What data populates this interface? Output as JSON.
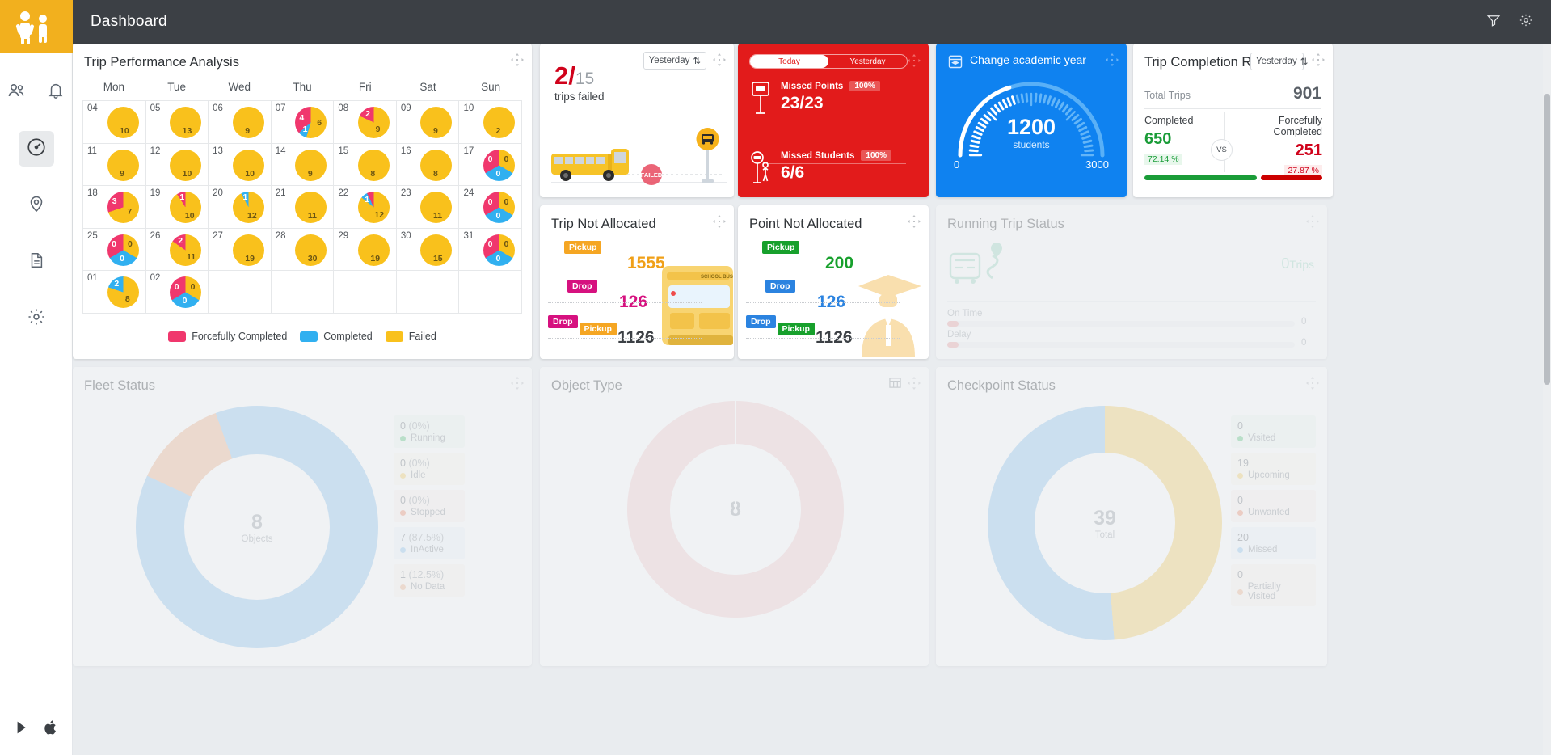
{
  "app": {
    "header_title": "Dashboard",
    "header_icons": [
      "filter-icon",
      "gear-icon"
    ],
    "rail_icons": [
      "users-icon",
      "bell-icon",
      "speedometer-icon",
      "map-pin-icon",
      "document-icon",
      "settings-icon"
    ],
    "rail_bottom_icons": [
      "android-icon",
      "apple-icon"
    ]
  },
  "trip_performance": {
    "title": "Trip Performance Analysis",
    "day_headers": [
      "Mon",
      "Tue",
      "Wed",
      "Thu",
      "Fri",
      "Sat",
      "Sun"
    ],
    "legend": [
      {
        "label": "Forcefully Completed",
        "color": "#f0376d"
      },
      {
        "label": "Completed",
        "color": "#31b0f0"
      },
      {
        "label": "Failed",
        "color": "#f9c11c"
      }
    ],
    "weeks": [
      [
        {
          "day": "04",
          "slices": [
            {
              "v": 10,
              "color": "#f9c11c",
              "show": true
            }
          ]
        },
        {
          "day": "05",
          "slices": [
            {
              "v": 13,
              "color": "#f9c11c",
              "show": true
            }
          ]
        },
        {
          "day": "06",
          "slices": [
            {
              "v": 9,
              "color": "#f9c11c",
              "show": true
            }
          ]
        },
        {
          "day": "07",
          "slices": [
            {
              "v": 6,
              "color": "#f9c11c",
              "show": true
            },
            {
              "v": 1,
              "color": "#31b0f0",
              "show": true
            },
            {
              "v": 4,
              "color": "#f0376d",
              "show": true
            }
          ]
        },
        {
          "day": "08",
          "slices": [
            {
              "v": 9,
              "color": "#f9c11c",
              "show": true
            },
            {
              "v": 2,
              "color": "#f0376d",
              "show": true
            }
          ]
        },
        {
          "day": "09",
          "slices": [
            {
              "v": 9,
              "color": "#f9c11c",
              "show": true
            }
          ]
        },
        {
          "day": "10",
          "slices": [
            {
              "v": 2,
              "color": "#f9c11c",
              "show": true
            }
          ]
        }
      ],
      [
        {
          "day": "11",
          "slices": [
            {
              "v": 9,
              "color": "#f9c11c",
              "show": true
            }
          ]
        },
        {
          "day": "12",
          "slices": [
            {
              "v": 10,
              "color": "#f9c11c",
              "show": true
            }
          ]
        },
        {
          "day": "13",
          "slices": [
            {
              "v": 10,
              "color": "#f9c11c",
              "show": true
            }
          ]
        },
        {
          "day": "14",
          "slices": [
            {
              "v": 9,
              "color": "#f9c11c",
              "show": true
            }
          ]
        },
        {
          "day": "15",
          "slices": [
            {
              "v": 8,
              "color": "#f9c11c",
              "show": true
            }
          ]
        },
        {
          "day": "16",
          "slices": [
            {
              "v": 8,
              "color": "#f9c11c",
              "show": true
            }
          ]
        },
        {
          "day": "17",
          "slices": [
            {
              "v": 0,
              "color": "#f9c11c",
              "show": true
            },
            {
              "v": 0,
              "color": "#31b0f0",
              "show": true
            },
            {
              "v": 0,
              "color": "#f0376d",
              "show": true
            }
          ]
        }
      ],
      [
        {
          "day": "18",
          "slices": [
            {
              "v": 7,
              "color": "#f9c11c",
              "show": true
            },
            {
              "v": 3,
              "color": "#f0376d",
              "show": true
            }
          ]
        },
        {
          "day": "19",
          "slices": [
            {
              "v": 10,
              "color": "#f9c11c",
              "show": true
            },
            {
              "v": 1,
              "color": "#f0376d",
              "show": true
            }
          ]
        },
        {
          "day": "20",
          "slices": [
            {
              "v": 12,
              "color": "#f9c11c",
              "show": true
            },
            {
              "v": 1,
              "color": "#31b0f0",
              "show": true
            }
          ]
        },
        {
          "day": "21",
          "slices": [
            {
              "v": 11,
              "color": "#f9c11c",
              "show": true
            }
          ]
        },
        {
          "day": "22",
          "slices": [
            {
              "v": 12,
              "color": "#f9c11c",
              "show": true
            },
            {
              "v": 1,
              "color": "#31b0f0",
              "show": true
            },
            {
              "v": 1,
              "color": "#f0376d",
              "show": false
            }
          ]
        },
        {
          "day": "23",
          "slices": [
            {
              "v": 11,
              "color": "#f9c11c",
              "show": true
            }
          ]
        },
        {
          "day": "24",
          "slices": [
            {
              "v": 0,
              "color": "#f9c11c",
              "show": true
            },
            {
              "v": 0,
              "color": "#31b0f0",
              "show": true
            },
            {
              "v": 0,
              "color": "#f0376d",
              "show": true
            }
          ]
        }
      ],
      [
        {
          "day": "25",
          "slices": [
            {
              "v": 0,
              "color": "#f9c11c",
              "show": true
            },
            {
              "v": 0,
              "color": "#31b0f0",
              "show": true
            },
            {
              "v": 0,
              "color": "#f0376d",
              "show": true
            }
          ]
        },
        {
          "day": "26",
          "slices": [
            {
              "v": 11,
              "color": "#f9c11c",
              "show": true
            },
            {
              "v": 2,
              "color": "#f0376d",
              "show": true
            }
          ]
        },
        {
          "day": "27",
          "slices": [
            {
              "v": 19,
              "color": "#f9c11c",
              "show": true
            }
          ]
        },
        {
          "day": "28",
          "slices": [
            {
              "v": 30,
              "color": "#f9c11c",
              "show": true
            }
          ]
        },
        {
          "day": "29",
          "slices": [
            {
              "v": 19,
              "color": "#f9c11c",
              "show": true
            }
          ]
        },
        {
          "day": "30",
          "slices": [
            {
              "v": 15,
              "color": "#f9c11c",
              "show": true
            }
          ]
        },
        {
          "day": "31",
          "slices": [
            {
              "v": 0,
              "color": "#f9c11c",
              "show": true
            },
            {
              "v": 0,
              "color": "#31b0f0",
              "show": true
            },
            {
              "v": 0,
              "color": "#f0376d",
              "show": true
            }
          ]
        }
      ],
      [
        {
          "day": "01",
          "slices": [
            {
              "v": 8,
              "color": "#f9c11c",
              "show": true
            },
            {
              "v": 2,
              "color": "#31b0f0",
              "show": true
            }
          ]
        },
        {
          "day": "02",
          "slices": [
            {
              "v": 0,
              "color": "#f9c11c",
              "show": true
            },
            {
              "v": 0,
              "color": "#31b0f0",
              "show": true
            },
            {
              "v": 0,
              "color": "#f0376d",
              "show": true
            }
          ]
        },
        {
          "day": "",
          "slices": []
        },
        {
          "day": "",
          "slices": []
        },
        {
          "day": "",
          "slices": []
        },
        {
          "day": "",
          "slices": []
        },
        {
          "day": "",
          "slices": []
        }
      ]
    ]
  },
  "trips_failed": {
    "failed": "2/",
    "total": "15",
    "subtitle": "trips failed",
    "period": "Yesterday",
    "stamp": "FAILED"
  },
  "missed": {
    "tab_today": "Today",
    "tab_yesterday": "Yesterday",
    "active_tab": "Today",
    "rows": [
      {
        "label": "Missed Points",
        "percent": "100%",
        "value": "23/23",
        "icon": "bus-stop-sign-icon"
      },
      {
        "label": "Missed Students",
        "percent": "100%",
        "value": "6/6",
        "icon": "student-at-stop-icon"
      }
    ],
    "bg_color": "#e21b1b"
  },
  "academic_year": {
    "title": "Change academic year",
    "value": "1200",
    "unit": "students",
    "min": "0",
    "max": "3000",
    "bg_color": "#0f82f0"
  },
  "completion_ratio": {
    "title": "Trip Completion Ratio",
    "period": "Yesterday",
    "total_label": "Total Trips",
    "total_value": "901",
    "completed_label": "Completed",
    "completed_value": "650",
    "completed_pct": "72.14 %",
    "forceful_label": "Forcefully Completed",
    "forceful_value": "251",
    "forceful_pct": "27.87 %",
    "vs": "VS",
    "completed_color": "#1a9c38",
    "forceful_color": "#d0021b"
  },
  "trip_not_allocated": {
    "title": "Trip Not Allocated",
    "rows": [
      {
        "tags": [
          "Pickup"
        ],
        "value": "1555",
        "value_color": "#f0a018",
        "tag_colors": [
          "#f5a623"
        ]
      },
      {
        "tags": [
          "Drop"
        ],
        "value": "126",
        "value_color": "#d6117f",
        "tag_colors": [
          "#d6117f"
        ]
      },
      {
        "tags": [
          "Drop",
          "Pickup"
        ],
        "value": "1126",
        "value_color": "#3c4045",
        "tag_colors": [
          "#d6117f",
          "#f5a623"
        ]
      }
    ]
  },
  "point_not_allocated": {
    "title": "Point Not Allocated",
    "rows": [
      {
        "tags": [
          "Pickup"
        ],
        "value": "200",
        "value_color": "#17a02c",
        "tag_colors": [
          "#17a02c"
        ]
      },
      {
        "tags": [
          "Drop"
        ],
        "value": "126",
        "value_color": "#2b83e0",
        "tag_colors": [
          "#2b83e0"
        ]
      },
      {
        "tags": [
          "Drop",
          "Pickup"
        ],
        "value": "1126",
        "value_color": "#3c4045",
        "tag_colors": [
          "#2b83e0",
          "#17a02c"
        ]
      }
    ]
  },
  "running_trip": {
    "title": "Running Trip Status",
    "trips_value": "0",
    "trips_unit": "Trips",
    "bars": [
      {
        "label": "On Time",
        "value": "0"
      },
      {
        "label": "Delay",
        "value": "0"
      }
    ]
  },
  "fleet_status": {
    "title": "Fleet Status",
    "center_value": "8",
    "center_label": "Objects",
    "items": [
      {
        "value": "0",
        "pct": "(0%)",
        "label": "Running",
        "color": "#57c47a",
        "bg": "#f2fbf5"
      },
      {
        "value": "0",
        "pct": "(0%)",
        "label": "Idle",
        "color": "#f7d063",
        "bg": "#fdfbf0"
      },
      {
        "value": "0",
        "pct": "(0%)",
        "label": "Stopped",
        "color": "#f08a6a",
        "bg": "#fdf3f0"
      },
      {
        "value": "7",
        "pct": "(87.5%)",
        "label": "InActive",
        "color": "#8ec5f0",
        "bg": "#f1f7fd"
      },
      {
        "value": "1",
        "pct": "(12.5%)",
        "label": "No Data",
        "color": "#f0b48a",
        "bg": "#fdf6f1"
      }
    ]
  },
  "object_type": {
    "title": "Object Type",
    "center_value": "8",
    "icons": [
      "table-icon",
      "drag-icon"
    ]
  },
  "checkpoint_status": {
    "title": "Checkpoint Status",
    "center_value": "39",
    "center_label": "Total",
    "items": [
      {
        "value": "0",
        "label": "Visited",
        "color": "#57c47a",
        "bg": "#f2fbf5"
      },
      {
        "value": "19",
        "label": "Upcoming",
        "color": "#f7d063",
        "bg": "#fdfbf0"
      },
      {
        "value": "0",
        "label": "Unwanted",
        "color": "#f08a6a",
        "bg": "#fdf3f0"
      },
      {
        "value": "20",
        "label": "Missed",
        "color": "#8ec5f0",
        "bg": "#f1f7fd"
      },
      {
        "value": "0",
        "label": "Partially Visited",
        "color": "#f0b48a",
        "bg": "#fdf6f1"
      }
    ]
  }
}
